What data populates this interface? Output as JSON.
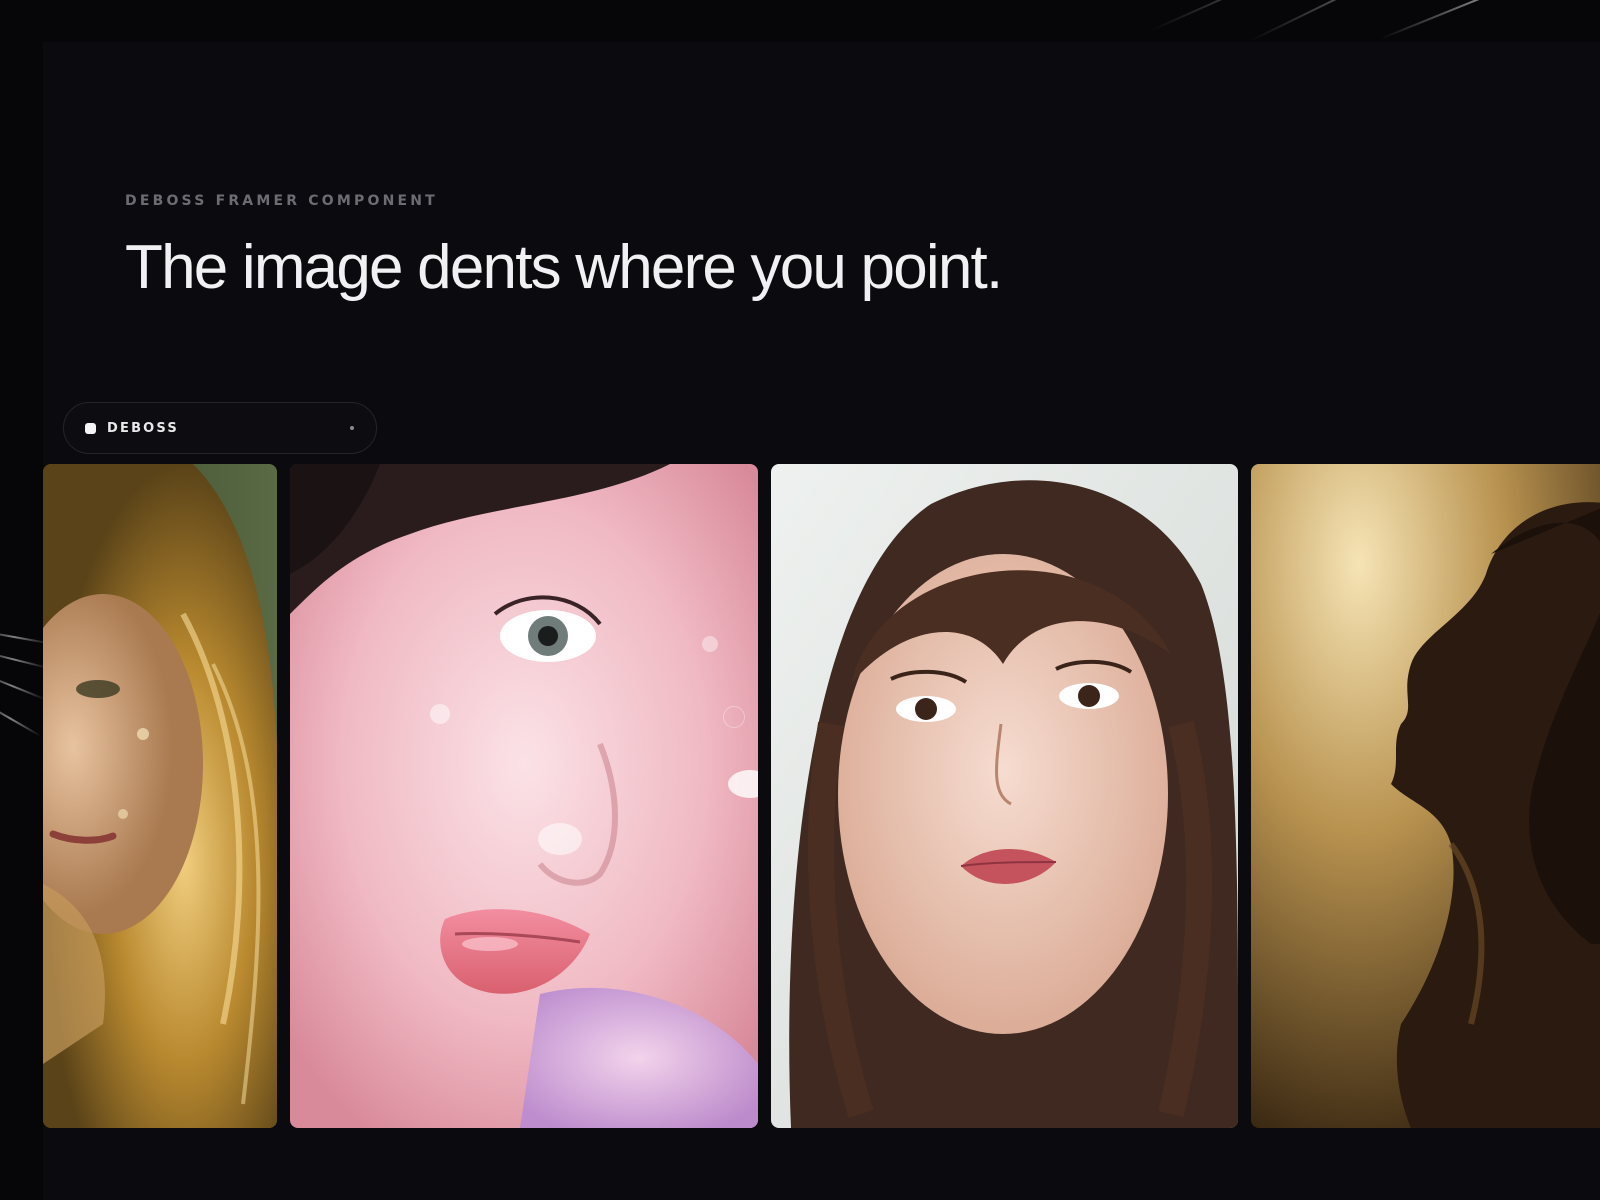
{
  "header": {
    "eyebrow": "DEBOSS FRAMER COMPONENT",
    "headline": "The image dents where you point."
  },
  "selector": {
    "label": "DEBOSS"
  },
  "gallery": {
    "cards": [
      {
        "name": "golden-hair-portrait",
        "palette": [
          "#556040",
          "#c4953c",
          "#e9c777"
        ]
      },
      {
        "name": "pink-glossy-portrait",
        "palette": [
          "#f2c9d2",
          "#e8a6b2",
          "#2b1d1f"
        ]
      },
      {
        "name": "bangs-portrait",
        "palette": [
          "#e3e6e4",
          "#4a2e22",
          "#f1d0c3"
        ]
      },
      {
        "name": "silhouette-portrait",
        "palette": [
          "#f2dfae",
          "#8a6a33",
          "#2a1a10"
        ]
      }
    ]
  },
  "colors": {
    "background": "#0b0b0f",
    "headline": "#f1f1f3",
    "eyebrow": "#6c6c72"
  }
}
